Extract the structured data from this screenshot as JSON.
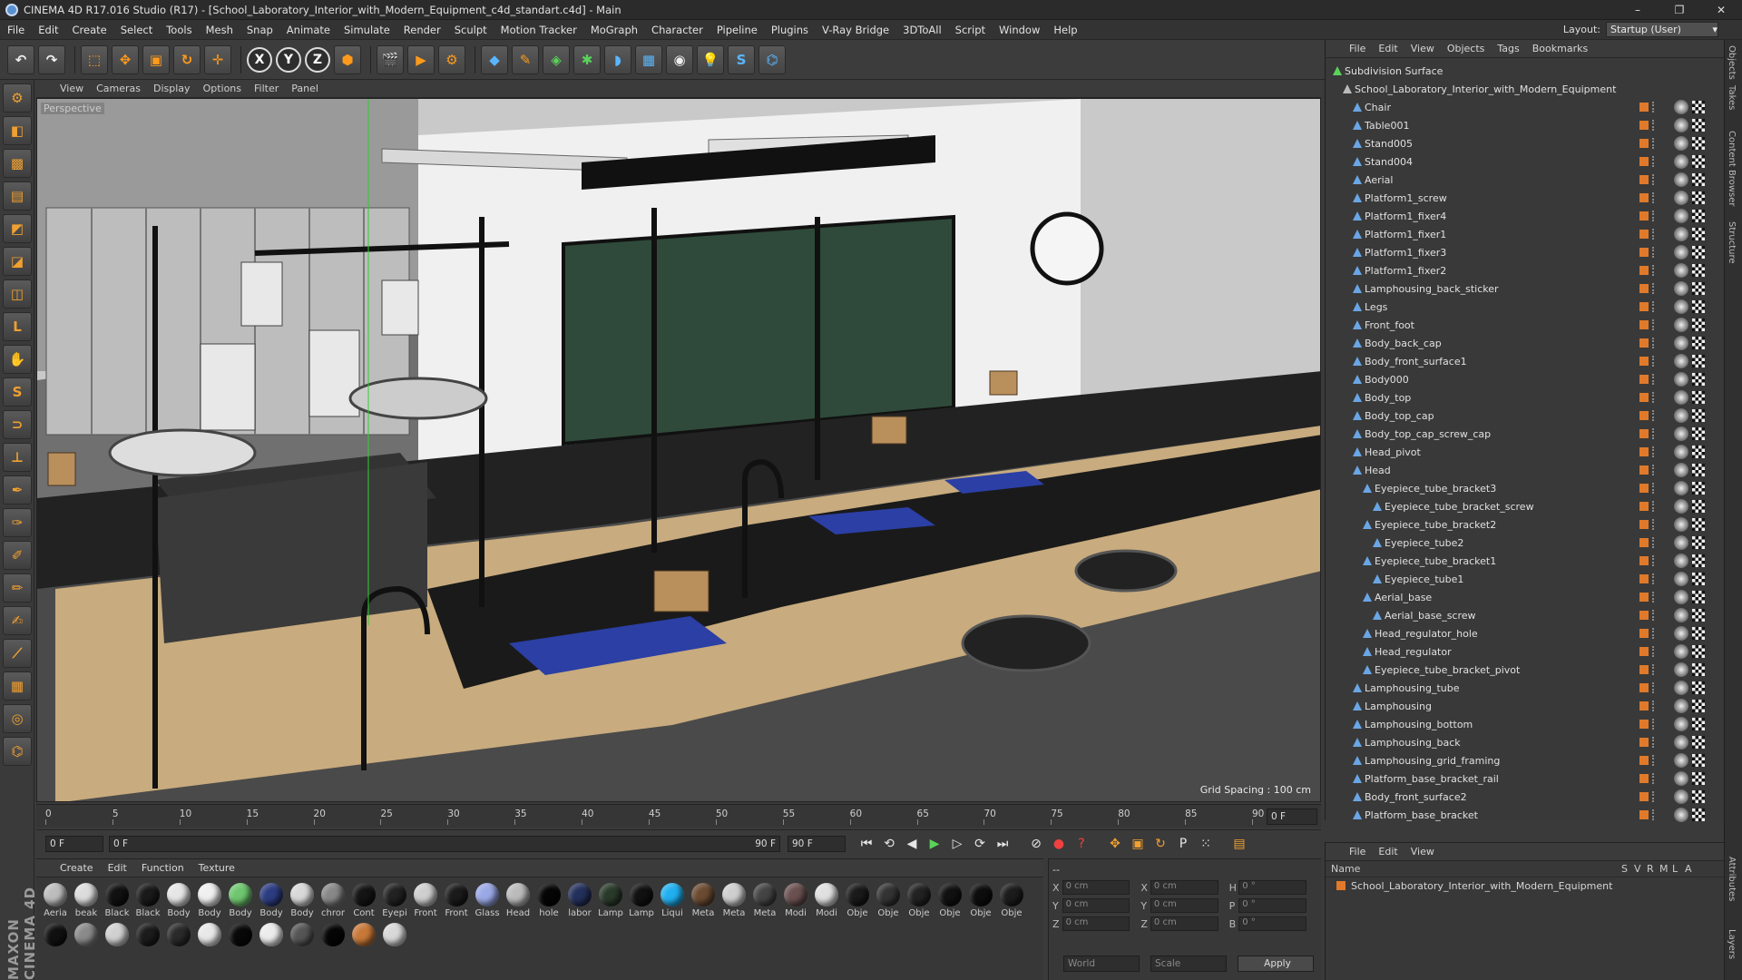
{
  "app": {
    "title": "CINEMA 4D R17.016 Studio (R17) - [School_Laboratory_Interior_with_Modern_Equipment_c4d_standart.c4d] - Main",
    "window_controls": [
      "–",
      "❐",
      "✕"
    ]
  },
  "menu": [
    "File",
    "Edit",
    "Create",
    "Select",
    "Tools",
    "Mesh",
    "Snap",
    "Animate",
    "Simulate",
    "Render",
    "Sculpt",
    "Motion Tracker",
    "MoGraph",
    "Character",
    "Pipeline",
    "Plugins",
    "V-Ray Bridge",
    "3DToAll",
    "Script",
    "Window",
    "Help"
  ],
  "layout": {
    "label": "Layout:",
    "value": "Startup (User)"
  },
  "toolbar": {
    "x": "X",
    "y": "Y",
    "z": "Z"
  },
  "viewport": {
    "menu": [
      "View",
      "Cameras",
      "Display",
      "Options",
      "Filter",
      "Panel"
    ],
    "camera_label": "Perspective",
    "grid_spacing": "Grid Spacing : 100 cm"
  },
  "timeline": {
    "ticks": [
      "0",
      "5",
      "10",
      "15",
      "20",
      "25",
      "30",
      "35",
      "40",
      "45",
      "50",
      "55",
      "60",
      "65",
      "70",
      "75",
      "80",
      "85",
      "90"
    ],
    "frame_end_label": "0 F"
  },
  "playback": {
    "current": "0 F",
    "start": "0 F",
    "end": "90 F",
    "end2": "90 F"
  },
  "materials": {
    "menu": [
      "Create",
      "Edit",
      "Function",
      "Texture"
    ],
    "row1": [
      {
        "n": "Aeria",
        "c": "#bdbdbd"
      },
      {
        "n": "beak",
        "c": "#dcdcdc"
      },
      {
        "n": "Black",
        "c": "#111"
      },
      {
        "n": "Black",
        "c": "#1a1a1a"
      },
      {
        "n": "Body",
        "c": "#e6e6e6"
      },
      {
        "n": "Body",
        "c": "#f0f0f0"
      },
      {
        "n": "Body",
        "c": "#6fc66f"
      },
      {
        "n": "Body",
        "c": "#2c3c80"
      },
      {
        "n": "Body",
        "c": "#d8d8d8"
      },
      {
        "n": "chror",
        "c": "#888"
      },
      {
        "n": "Cont",
        "c": "#141414"
      },
      {
        "n": "Eyepi",
        "c": "#222"
      },
      {
        "n": "Front",
        "c": "#cfcfcf"
      },
      {
        "n": "Front",
        "c": "#1b1b1b"
      },
      {
        "n": "Glass",
        "c": "#9aa8e6"
      },
      {
        "n": "Head",
        "c": "#bbb"
      },
      {
        "n": "hole",
        "c": "#050505"
      },
      {
        "n": "labor",
        "c": "#24305c"
      },
      {
        "n": "Lamp",
        "c": "#2a3a2a"
      },
      {
        "n": "Lamp",
        "c": "#111"
      },
      {
        "n": "Liqui",
        "c": "#20b0f0"
      },
      {
        "n": "Meta",
        "c": "#6a4a30"
      },
      {
        "n": "Meta",
        "c": "#cfcfcf"
      },
      {
        "n": "Meta",
        "c": "#444"
      },
      {
        "n": "Modi",
        "c": "#6a5050"
      },
      {
        "n": "Modi",
        "c": "#e0e0e0"
      },
      {
        "n": "Obje",
        "c": "#1a1a1a"
      },
      {
        "n": "Obje",
        "c": "#333"
      },
      {
        "n": "Obje",
        "c": "#222"
      },
      {
        "n": "Obje",
        "c": "#111"
      },
      {
        "n": "Obje",
        "c": "#0d0d0d"
      },
      {
        "n": "Obje",
        "c": "#1c1c1c"
      }
    ],
    "row2": [
      {
        "n": "",
        "c": "#111"
      },
      {
        "n": "",
        "c": "#8a8a8a"
      },
      {
        "n": "",
        "c": "#d0d0d0"
      },
      {
        "n": "",
        "c": "#1c1c1c"
      },
      {
        "n": "",
        "c": "#2a2a2a"
      },
      {
        "n": "",
        "c": "#e8e8e8"
      },
      {
        "n": "",
        "c": "#080808"
      },
      {
        "n": "",
        "c": "#ececec"
      },
      {
        "n": "",
        "c": "#555"
      },
      {
        "n": "",
        "c": "#050505"
      },
      {
        "n": "",
        "c": "#c87838"
      },
      {
        "n": "",
        "c": "#d8d8d8"
      }
    ]
  },
  "coords": {
    "header": "--",
    "rows": [
      {
        "a": "X",
        "v": "0 cm",
        "b": "X",
        "v2": "0 cm",
        "c": "H",
        "v3": "0 °"
      },
      {
        "a": "Y",
        "v": "0 cm",
        "b": "Y",
        "v2": "0 cm",
        "c": "P",
        "v3": "0 °"
      },
      {
        "a": "Z",
        "v": "0 cm",
        "b": "Z",
        "v2": "0 cm",
        "c": "B",
        "v3": "0 °"
      }
    ],
    "mode1": "World",
    "mode2": "Scale",
    "apply": "Apply"
  },
  "objects": {
    "menu": [
      "File",
      "Edit",
      "View",
      "Objects",
      "Tags",
      "Bookmarks"
    ],
    "items": [
      {
        "name": "Subdivision Surface",
        "d": 0,
        "c": "#5ad35a"
      },
      {
        "name": "School_Laboratory_Interior_with_Modern_Equipment",
        "d": 1,
        "c": "#bbb"
      },
      {
        "name": "Chair",
        "d": 2
      },
      {
        "name": "Table001",
        "d": 2
      },
      {
        "name": "Stand005",
        "d": 2
      },
      {
        "name": "Stand004",
        "d": 2
      },
      {
        "name": "Aerial",
        "d": 2
      },
      {
        "name": "Platform1_screw",
        "d": 2
      },
      {
        "name": "Platform1_fixer4",
        "d": 2
      },
      {
        "name": "Platform1_fixer1",
        "d": 2
      },
      {
        "name": "Platform1_fixer3",
        "d": 2
      },
      {
        "name": "Platform1_fixer2",
        "d": 2
      },
      {
        "name": "Lamphousing_back_sticker",
        "d": 2
      },
      {
        "name": "Legs",
        "d": 2
      },
      {
        "name": "Front_foot",
        "d": 2
      },
      {
        "name": "Body_back_cap",
        "d": 2
      },
      {
        "name": "Body_front_surface1",
        "d": 2
      },
      {
        "name": "Body000",
        "d": 2
      },
      {
        "name": "Body_top",
        "d": 2
      },
      {
        "name": "Body_top_cap",
        "d": 2
      },
      {
        "name": "Body_top_cap_screw_cap",
        "d": 2
      },
      {
        "name": "Head_pivot",
        "d": 2
      },
      {
        "name": "Head",
        "d": 2
      },
      {
        "name": "Eyepiece_tube_bracket3",
        "d": 3
      },
      {
        "name": "Eyepiece_tube_bracket_screw",
        "d": 4
      },
      {
        "name": "Eyepiece_tube_bracket2",
        "d": 3
      },
      {
        "name": "Eyepiece_tube2",
        "d": 4
      },
      {
        "name": "Eyepiece_tube_bracket1",
        "d": 3
      },
      {
        "name": "Eyepiece_tube1",
        "d": 4
      },
      {
        "name": "Aerial_base",
        "d": 3
      },
      {
        "name": "Aerial_base_screw",
        "d": 4
      },
      {
        "name": "Head_regulator_hole",
        "d": 3
      },
      {
        "name": "Head_regulator",
        "d": 3
      },
      {
        "name": "Eyepiece_tube_bracket_pivot",
        "d": 3
      },
      {
        "name": "Lamphousing_tube",
        "d": 2
      },
      {
        "name": "Lamphousing",
        "d": 2
      },
      {
        "name": "Lamphousing_bottom",
        "d": 2
      },
      {
        "name": "Lamphousing_back",
        "d": 2
      },
      {
        "name": "Lamphousing_grid_framing",
        "d": 2
      },
      {
        "name": "Platform_base_bracket_rail",
        "d": 2
      },
      {
        "name": "Body_front_surface2",
        "d": 2
      },
      {
        "name": "Platform_base_bracket",
        "d": 2
      }
    ]
  },
  "attributes": {
    "menu": [
      "File",
      "Edit",
      "View"
    ],
    "cols": [
      "Name",
      "S",
      "V",
      "R",
      "M",
      "L",
      "A"
    ],
    "row": "School_Laboratory_Interior_with_Modern_Equipment"
  },
  "side_tabs": [
    "Objects",
    "Takes",
    "Content Browser",
    "Structure",
    "Attributes",
    "Layers"
  ],
  "brand": "MAXON CINEMA 4D"
}
